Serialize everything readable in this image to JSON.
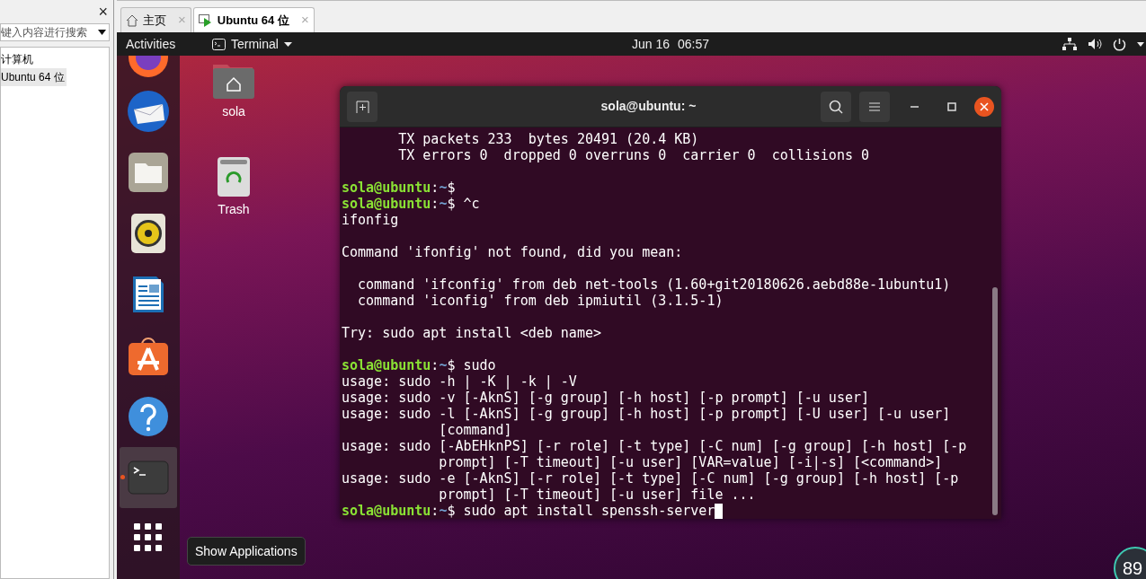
{
  "library": {
    "close": "×",
    "search": {
      "placeholder": "键入内容进行搜索"
    },
    "tree": [
      {
        "label": "计算机",
        "selected": false
      },
      {
        "label": "Ubuntu 64 位",
        "selected": true
      }
    ]
  },
  "tabs": [
    {
      "label": "主页",
      "kind": "home",
      "selected": false,
      "close": "×"
    },
    {
      "label": "Ubuntu 64 位",
      "kind": "vm",
      "selected": true,
      "close": "×"
    }
  ],
  "topbar": {
    "activities": "Activities",
    "app": "Terminal",
    "date": "Jun 16",
    "time": "06:57"
  },
  "desktop_icons": [
    {
      "kind": "home",
      "label": "sola"
    },
    {
      "kind": "trash",
      "label": "Trash"
    }
  ],
  "dock": [
    {
      "kind": "firefox",
      "running": false
    },
    {
      "kind": "mail",
      "running": false
    },
    {
      "kind": "files",
      "running": false
    },
    {
      "kind": "speaker",
      "running": false
    },
    {
      "kind": "writer",
      "running": false
    },
    {
      "kind": "store",
      "running": false
    },
    {
      "kind": "help",
      "running": false
    },
    {
      "kind": "terminal",
      "running": true
    }
  ],
  "tooltip": "Show Applications",
  "terminal": {
    "title": "sola@ubuntu: ~",
    "lines": [
      {
        "kind": "output",
        "text": "       TX packets 233  bytes 20491 (20.4 KB)"
      },
      {
        "kind": "output",
        "text": "       TX errors 0  dropped 0 overruns 0  carrier 0  collisions 0"
      },
      {
        "kind": "blank"
      },
      {
        "kind": "prompt",
        "user": "sola@ubuntu",
        "separator": ":",
        "path": "~",
        "symbol": "$",
        "cursor": false
      },
      {
        "kind": "prompt",
        "user": "sola@ubuntu",
        "separator": ":",
        "path": "~",
        "symbol": "$",
        "command": "^c",
        "cursor": false
      },
      {
        "kind": "output",
        "text": "ifonfig"
      },
      {
        "kind": "blank"
      },
      {
        "kind": "output",
        "text": "Command 'ifonfig' not found, did you mean:"
      },
      {
        "kind": "blank"
      },
      {
        "kind": "output",
        "text": "  command 'ifconfig' from deb net-tools (1.60+git20180626.aebd88e-1ubuntu1)"
      },
      {
        "kind": "output",
        "text": "  command 'iconfig' from deb ipmiutil (3.1.5-1)"
      },
      {
        "kind": "blank"
      },
      {
        "kind": "output",
        "text": "Try: sudo apt install <deb name>"
      },
      {
        "kind": "blank"
      },
      {
        "kind": "prompt",
        "user": "sola@ubuntu",
        "separator": ":",
        "path": "~",
        "symbol": "$",
        "command": "sudo",
        "cursor": false
      },
      {
        "kind": "output",
        "text": "usage: sudo -h | -K | -k | -V"
      },
      {
        "kind": "output",
        "text": "usage: sudo -v [-AknS] [-g group] [-h host] [-p prompt] [-u user]"
      },
      {
        "kind": "output",
        "text": "usage: sudo -l [-AknS] [-g group] [-h host] [-p prompt] [-U user] [-u user]"
      },
      {
        "kind": "output",
        "text": "            [command]"
      },
      {
        "kind": "output",
        "text": "usage: sudo [-AbEHknPS] [-r role] [-t type] [-C num] [-g group] [-h host] [-p"
      },
      {
        "kind": "output",
        "text": "            prompt] [-T timeout] [-u user] [VAR=value] [-i|-s] [<command>]"
      },
      {
        "kind": "output",
        "text": "usage: sudo -e [-AknS] [-r role] [-t type] [-C num] [-g group] [-h host] [-p"
      },
      {
        "kind": "output",
        "text": "            prompt] [-T timeout] [-u user] file ..."
      },
      {
        "kind": "prompt",
        "user": "sola@ubuntu",
        "separator": ":",
        "path": "~",
        "symbol": "$",
        "command": "sudo apt install spenssh-server",
        "cursor": true
      }
    ]
  },
  "gauge": {
    "value": "89"
  }
}
